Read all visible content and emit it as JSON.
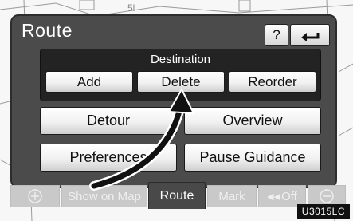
{
  "header": {
    "title": "Route",
    "help_label": "?"
  },
  "destination": {
    "label": "Destination",
    "buttons": [
      "Add",
      "Delete",
      "Reorder"
    ]
  },
  "actions": {
    "detour": "Detour",
    "overview": "Overview",
    "preferences": "Preferences",
    "pause_guidance": "Pause Guidance"
  },
  "bottom_bar": {
    "show_on_map": "Show on Map",
    "route": "Route",
    "mark": "Mark",
    "off": "Off"
  },
  "image_code": "U3015LC"
}
